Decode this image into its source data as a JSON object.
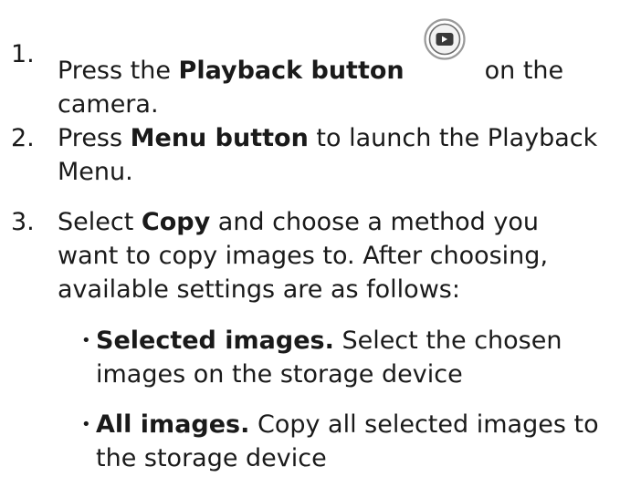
{
  "steps": [
    {
      "number": "1.",
      "line1_pre": "Press the ",
      "line1_bold": "Playback button",
      "line1_post": "on the",
      "line2": "camera.",
      "icon": "playback-button-icon"
    },
    {
      "number": "2.",
      "line1_pre": "Press ",
      "line1_bold": "Menu button",
      "line1_post": " to launch the Playback",
      "line2": "Menu."
    },
    {
      "number": "3.",
      "line1_pre": "Select ",
      "line1_bold": "Copy",
      "line1_post": " and choose a method you",
      "line2": "want to copy images to. After choosing,",
      "line3": "available settings are as follows:"
    }
  ],
  "bullets": [
    {
      "marker": "•",
      "bold": "Selected images.",
      "line1_post": " Select the chosen",
      "line2": "images on the storage device"
    },
    {
      "marker": "•",
      "bold": "All images.",
      "line1_post": " Copy all selected images to",
      "line2": "the storage device"
    }
  ],
  "colors": {
    "text": "#1a1a1a",
    "icon_ring": "#9a9a9a",
    "icon_fill": "#3a3a3a"
  }
}
